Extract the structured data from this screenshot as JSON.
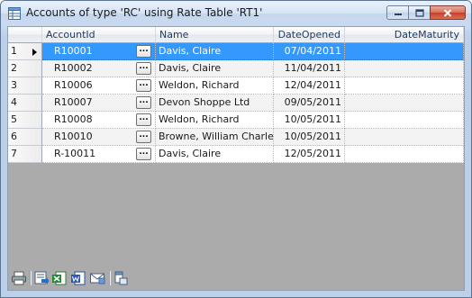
{
  "window": {
    "title": "Accounts of type 'RC' using Rate Table 'RT1'",
    "icon": "grid-table-icon"
  },
  "grid": {
    "columns": [
      "AccountId",
      "Name",
      "DateOpened",
      "DateMaturity"
    ],
    "rows": [
      {
        "num": "1",
        "account": "R10001",
        "name": "Davis, Claire",
        "opened": "07/04/2011",
        "maturity": ""
      },
      {
        "num": "2",
        "account": "R10002",
        "name": "Davis, Claire",
        "opened": "11/04/2011",
        "maturity": ""
      },
      {
        "num": "3",
        "account": "R10006",
        "name": "Weldon, Richard",
        "opened": "12/04/2011",
        "maturity": ""
      },
      {
        "num": "4",
        "account": "R10007",
        "name": "Devon Shoppe Ltd",
        "opened": "09/05/2011",
        "maturity": ""
      },
      {
        "num": "5",
        "account": "R10008",
        "name": "Weldon, Richard",
        "opened": "10/05/2011",
        "maturity": ""
      },
      {
        "num": "6",
        "account": "R10010",
        "name": "Browne, William Charles",
        "opened": "10/05/2011",
        "maturity": ""
      },
      {
        "num": "7",
        "account": "R-10011",
        "name": "Davis, Claire",
        "opened": "12/05/2011",
        "maturity": ""
      }
    ],
    "ellipsis_label": "..."
  },
  "toolbar": {
    "icons": [
      "print-icon",
      "export-icon",
      "excel-export-icon",
      "word-export-icon",
      "email-icon",
      "column-chooser-icon"
    ]
  },
  "colors": {
    "selection": "#3399ff",
    "window_frame": "#c6d7ee",
    "client_background": "#ababab"
  }
}
